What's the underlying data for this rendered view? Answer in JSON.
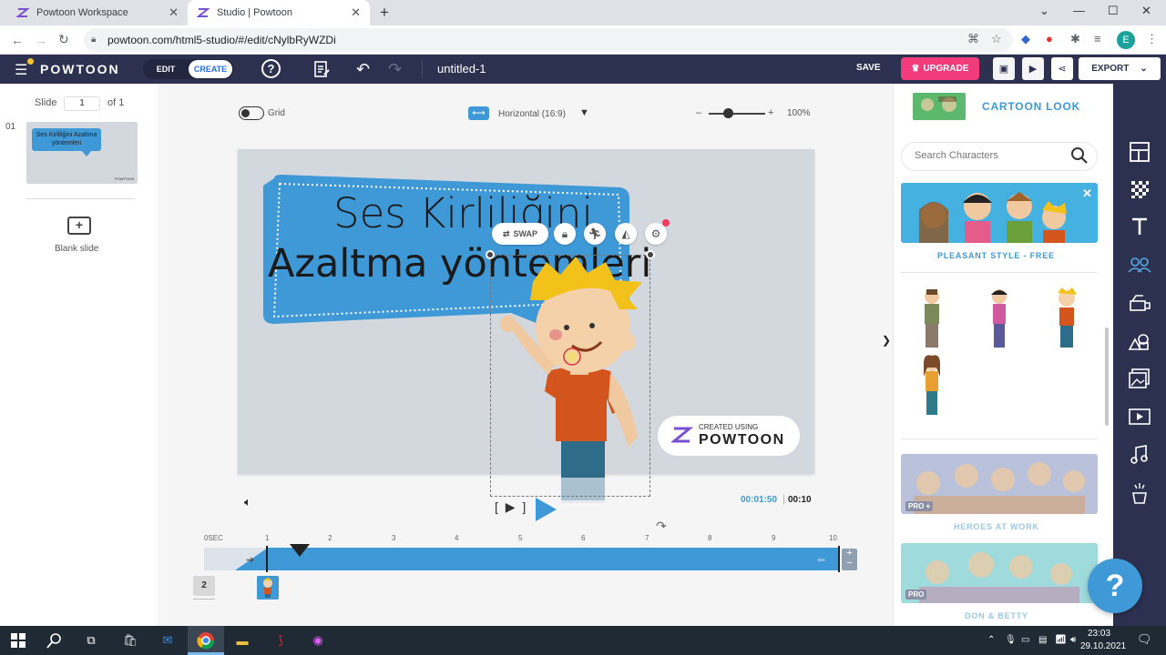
{
  "browser": {
    "tabs": [
      {
        "title": "Powtoon Workspace"
      },
      {
        "title": "Studio | Powtoon"
      }
    ],
    "url": "powtoon.com/html5-studio/#/edit/cNylbRyWZDi",
    "profile_initial": "E"
  },
  "header": {
    "logo": "POWTOON",
    "mode_edit": "EDIT",
    "mode_create": "CREATE",
    "doc_title": "untitled-1",
    "save": "SAVE",
    "upgrade": "UPGRADE",
    "export": "EXPORT"
  },
  "slides_panel": {
    "slide_label": "Slide",
    "slide_value": "1",
    "of_label": "of 1",
    "slides": [
      {
        "index": "01",
        "thumb_text": "Ses Kirliliğini Azaltma yöntemleri"
      }
    ],
    "blank_slide": "Blank slide"
  },
  "canvas_toolbar": {
    "grid_label": "Grid",
    "orientation": "Horizontal (16:9)",
    "zoom_minus": "–",
    "zoom_plus": "+",
    "zoom_value": "100%",
    "zoom_level": 0.35
  },
  "slide": {
    "title_line1": "Ses Kirliliğini",
    "title_line2": "Azaltma yöntemleri",
    "element_toolbar": {
      "swap": "SWAP"
    },
    "watermark_small": "CREATED USING",
    "watermark_big": "POWTOON"
  },
  "playback": {
    "current_time": "00:01:50",
    "separator": "|",
    "total_time": "00:10"
  },
  "timeline": {
    "ticks": [
      "0SEC",
      "1",
      "2",
      "3",
      "4",
      "5",
      "6",
      "7",
      "8",
      "9",
      "10"
    ],
    "layer_number": "2"
  },
  "library": {
    "look": "CARTOON LOOK",
    "search_placeholder": "Search Characters",
    "sections": [
      {
        "label": "PLEASANT STYLE - FREE"
      },
      {
        "label": "HEROES AT WORK",
        "badge": "PRO +"
      },
      {
        "label": "DON & BETTY",
        "badge": "PRO"
      }
    ]
  },
  "help": "?",
  "taskbar": {
    "time": "23:03",
    "date": "29.10.2021"
  },
  "colors": {
    "header_bg": "#2d3150",
    "accent_blue": "#3f99d6",
    "upgrade_pink": "#f13b7b",
    "canvas_bg": "#d3d8de"
  }
}
